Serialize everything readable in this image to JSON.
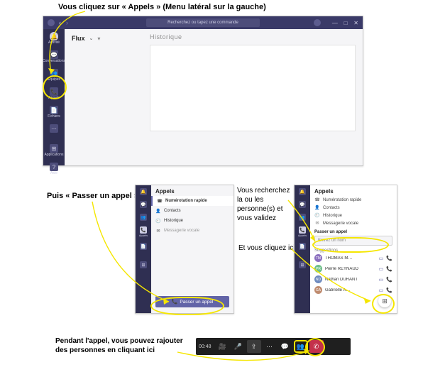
{
  "captions": {
    "top": "Vous cliquez sur « Appels » (Menu latéral sur la gauche)",
    "passer": "Puis « Passer un appel »",
    "recherche": "Vous recherchez la ou les personne(s) et vous validez",
    "clique_ici": "Et vous cliquez ici",
    "rajouter": "Pendant l'appel, vous pouvez rajouter des personnes en cliquant ici"
  },
  "titlebar": {
    "search_placeholder": "Recherchez ou tapez une commande"
  },
  "rail": {
    "items": [
      {
        "label": "Activité",
        "glyph": "🔔"
      },
      {
        "label": "Conversations",
        "glyph": "💬"
      },
      {
        "label": "Équipes",
        "glyph": "👥"
      },
      {
        "label": "Appels",
        "glyph": "📞"
      },
      {
        "label": "Fichiers",
        "glyph": "📄"
      },
      {
        "label": "",
        "glyph": "⋯"
      }
    ],
    "bottom": [
      {
        "label": "Applications",
        "glyph": "⊞"
      },
      {
        "label": "Aide",
        "glyph": "?"
      }
    ]
  },
  "flux": {
    "title": "Flux",
    "historique": "Historique"
  },
  "calls_panel": {
    "title": "Appels",
    "rows": [
      {
        "label": "Numérotation rapide",
        "glyph": "☎",
        "active": true
      },
      {
        "label": "Contacts",
        "glyph": "👤"
      },
      {
        "label": "Historique",
        "glyph": "🕘"
      },
      {
        "label": "Messagerie vocale",
        "glyph": "✉"
      }
    ],
    "button": "Passer un appel"
  },
  "search_panel": {
    "title": "Appels",
    "rows": [
      {
        "label": "Numérotation rapide",
        "glyph": "☎"
      },
      {
        "label": "Contacts",
        "glyph": "👤"
      },
      {
        "label": "Historique",
        "glyph": "🕘"
      },
      {
        "label": "Messagerie vocale",
        "glyph": "✉"
      }
    ],
    "section": "Passer un appel",
    "input_placeholder": "Entrez un nom",
    "suggestions": "Suggestions",
    "people": [
      {
        "name": "THOMAS M…",
        "initials": "TM"
      },
      {
        "name": "Pierre REYNAUD",
        "initials": "PR"
      },
      {
        "name": "Nathan DURANT",
        "initials": "ND"
      },
      {
        "name": "Gabrielle A…",
        "initials": "GA"
      }
    ]
  },
  "callbar": {
    "timer": "00:48"
  }
}
